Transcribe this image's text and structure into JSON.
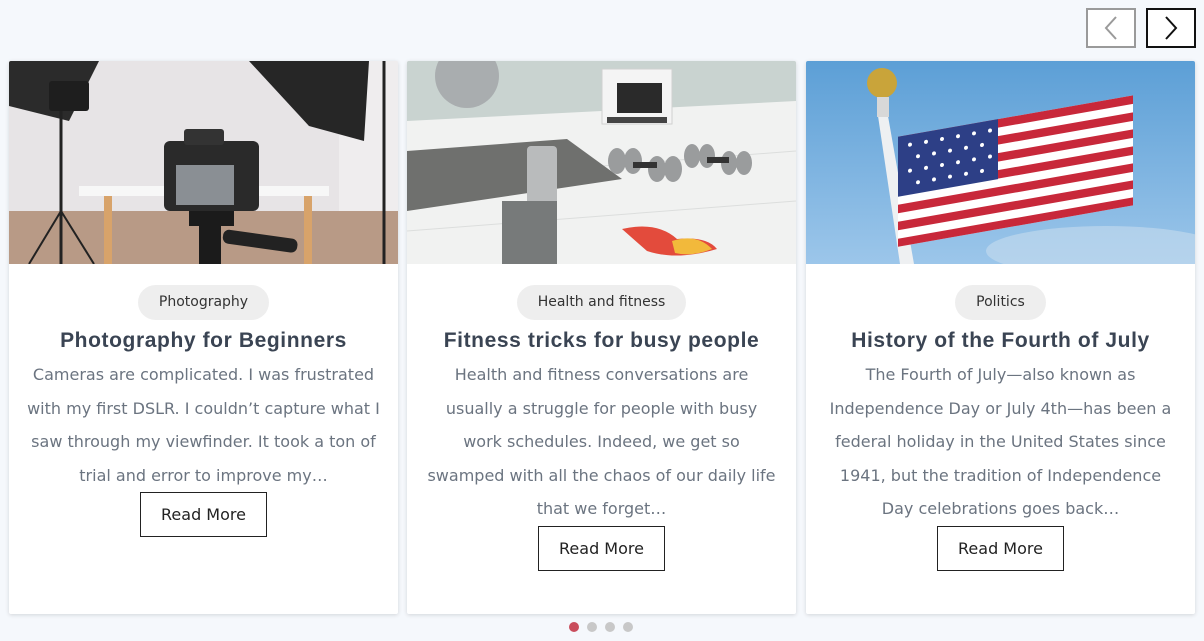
{
  "carousel": {
    "prev_icon": "chevron-left-icon",
    "next_icon": "chevron-right-icon",
    "cards": [
      {
        "category": "Photography",
        "title": "Photography for Beginners",
        "excerpt": "Cameras are complicated. I was frustrated with my first DSLR. I couldn’t capture what I saw through my viewfinder. It took a ton of trial and error to improve my…",
        "button": "Read More"
      },
      {
        "category": "Health and fitness",
        "title": "Fitness tricks for busy people",
        "excerpt": "Health and fitness conversations are usually a struggle for people with busy work schedules. Indeed, we get so swamped with all the chaos of our daily life that we forget…",
        "button": "Read More"
      },
      {
        "category": "Politics",
        "title": "History of the Fourth of July",
        "excerpt": "The Fourth of July—also known as Independence Day or July 4th—has been a federal holiday in the United States since 1941, but the tradition of Independence Day celebrations goes back…",
        "button": "Read More"
      }
    ],
    "pagination": {
      "total": 4,
      "active": 1
    }
  },
  "colors": {
    "accent": "#c94d5c",
    "dot_inactive": "#c8c8c8",
    "text": "#3a4453",
    "muted": "#6b7480"
  }
}
